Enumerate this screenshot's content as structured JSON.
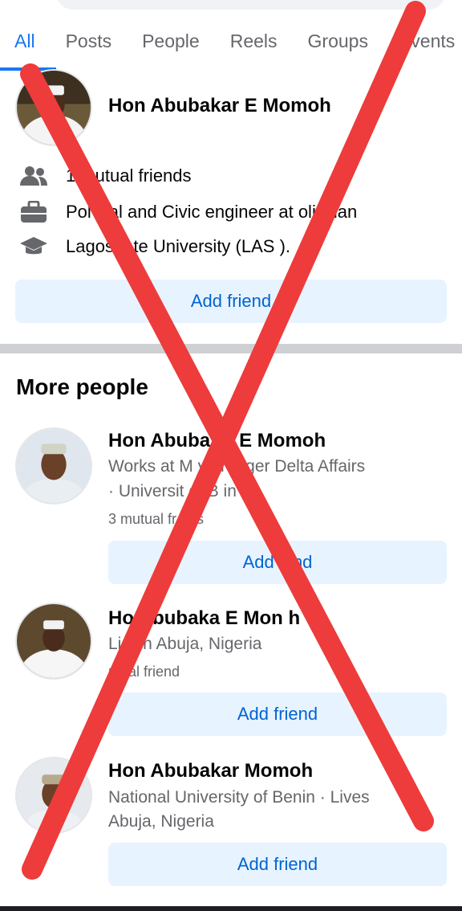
{
  "tabs": [
    {
      "label": "All",
      "active": true
    },
    {
      "label": "Posts",
      "active": false
    },
    {
      "label": "People",
      "active": false
    },
    {
      "label": "Reels",
      "active": false
    },
    {
      "label": "Groups",
      "active": false
    },
    {
      "label": "Events",
      "active": false
    }
  ],
  "top_result": {
    "name": "Hon Abubakar E Momoh",
    "info": [
      {
        "icon": "people-icon",
        "text": "1   mutual friends"
      },
      {
        "icon": "briefcase-icon",
        "text": "Pol   cial and Civic engineer at   olitician"
      },
      {
        "icon": "graduation-cap-icon",
        "text": "Lagos   tate University (LAS   )."
      }
    ],
    "button": "Add friend"
  },
  "more_people": {
    "title": "More people",
    "items": [
      {
        "name": "Hon Abuba   ar E Momoh",
        "line1": "Works at M        y of Niger Delta Affairs",
        "line2": "· Universit    of B    in",
        "meta": "3 mutual fr    nds",
        "button": "Add    iend"
      },
      {
        "name": "Ho   Abubaka E Mon   h",
        "line1": "Li     s in Abuja, Nigeria",
        "line2": "",
        "meta": "   utual friend",
        "button": "Add friend"
      },
      {
        "name": "Hon Abubakar Momoh",
        "line1": "National University of Benin · Lives",
        "line2": "Abuja, Nigeria",
        "meta": "",
        "button": "Add friend"
      }
    ]
  },
  "overlay": {
    "color": "#ee3b3b"
  }
}
